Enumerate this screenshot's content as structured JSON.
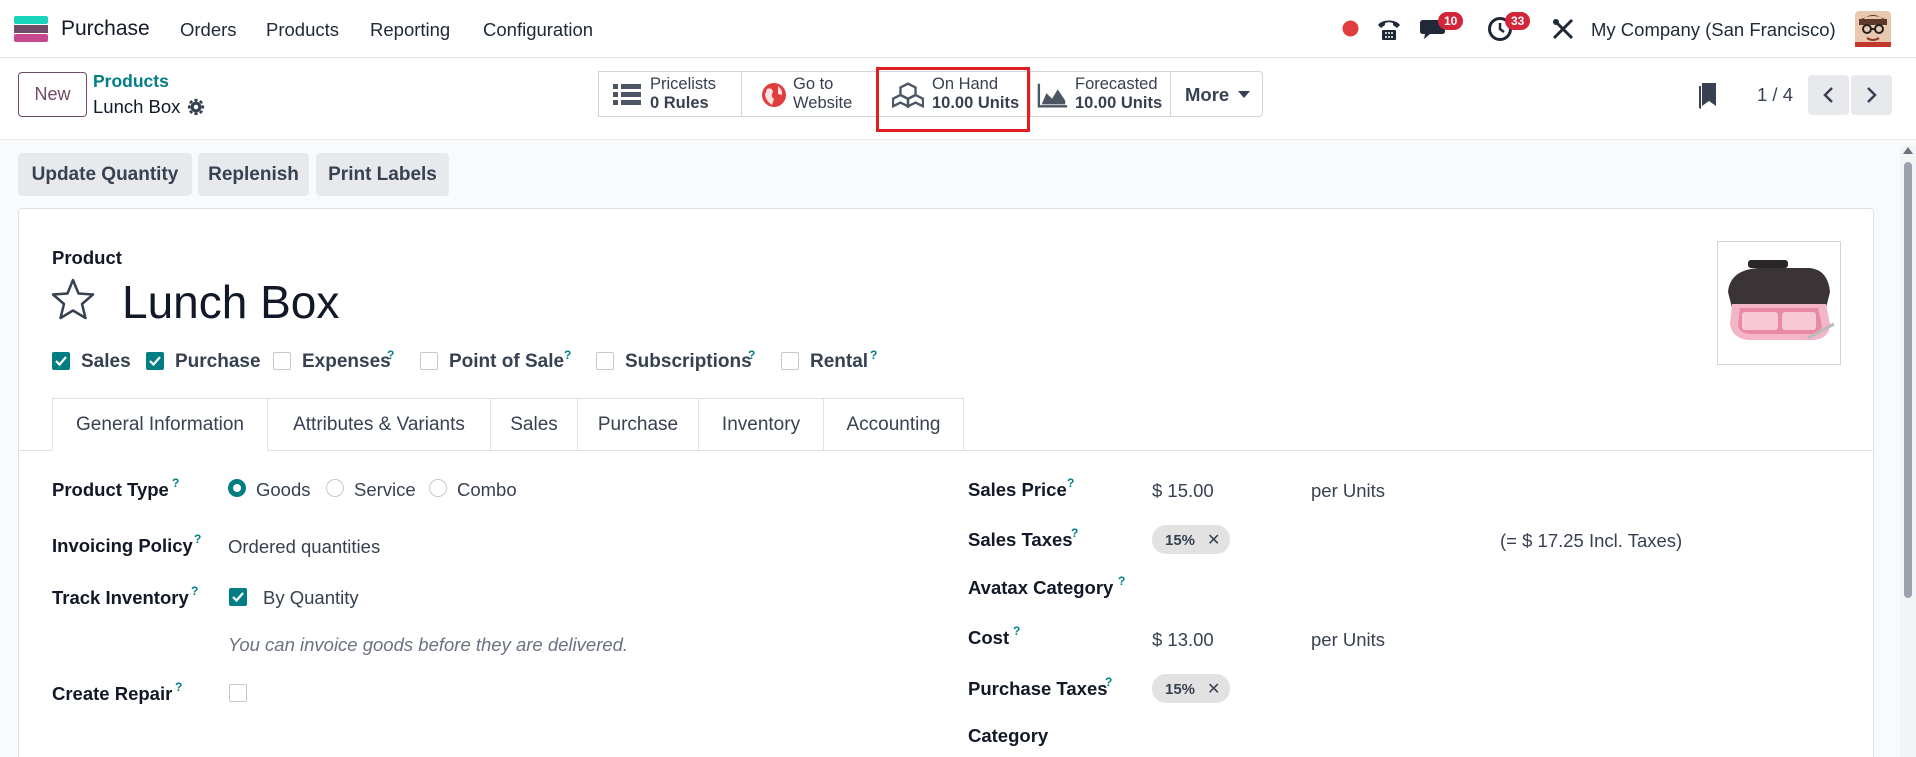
{
  "navbar": {
    "app_name": "Purchase",
    "menu": [
      "Orders",
      "Products",
      "Reporting",
      "Configuration"
    ],
    "chat_badge": "10",
    "activity_badge": "33",
    "company": "My Company (San Francisco)"
  },
  "control_panel": {
    "new_label": "New",
    "breadcrumb_parent": "Products",
    "breadcrumb_current": "Lunch Box",
    "smart_buttons": {
      "pricelists": {
        "line1": "Pricelists",
        "line2": "0  Rules"
      },
      "website": {
        "line1": "Go to",
        "line2": "Website"
      },
      "on_hand": {
        "line1": "On Hand",
        "line2": "10.00 Units"
      },
      "forecasted": {
        "line1": "Forecasted",
        "line2": "10.00 Units"
      },
      "more": "More"
    },
    "pager": "1 / 4"
  },
  "actions": [
    "Update Quantity",
    "Replenish",
    "Print Labels"
  ],
  "form": {
    "product_label": "Product",
    "name": "Lunch Box",
    "checkboxes": [
      {
        "label": "Sales",
        "checked": true
      },
      {
        "label": "Purchase",
        "checked": true
      },
      {
        "label": "Expenses",
        "checked": false
      },
      {
        "label": "Point of Sale",
        "checked": false
      },
      {
        "label": "Subscriptions",
        "checked": false
      },
      {
        "label": "Rental",
        "checked": false
      }
    ],
    "tabs": [
      "General Information",
      "Attributes & Variants",
      "Sales",
      "Purchase",
      "Inventory",
      "Accounting"
    ],
    "left": {
      "product_type_label": "Product Type",
      "product_type_options": [
        "Goods",
        "Service",
        "Combo"
      ],
      "invoicing_policy_label": "Invoicing Policy",
      "invoicing_policy_value": "Ordered quantities",
      "track_inventory_label": "Track Inventory",
      "track_inventory_value": "By Quantity",
      "hint": "You can invoice goods before they are delivered.",
      "create_repair_label": "Create Repair"
    },
    "right": {
      "sales_price_label": "Sales Price",
      "sales_price_value": "$ 15.00",
      "sales_price_unit": "per Units",
      "sales_taxes_label": "Sales Taxes",
      "sales_taxes_tag": "15%",
      "sales_taxes_incl": "(= $ 17.25 Incl. Taxes)",
      "avatax_label": "Avatax Category",
      "cost_label": "Cost",
      "cost_value": "$ 13.00",
      "cost_unit": "per Units",
      "purchase_taxes_label": "Purchase Taxes",
      "purchase_taxes_tag": "15%",
      "category_label": "Category"
    }
  },
  "colors": {
    "brand": "#714b67",
    "accent": "#017e84",
    "badge": "#d4263a",
    "highlight": "#e01e24"
  }
}
